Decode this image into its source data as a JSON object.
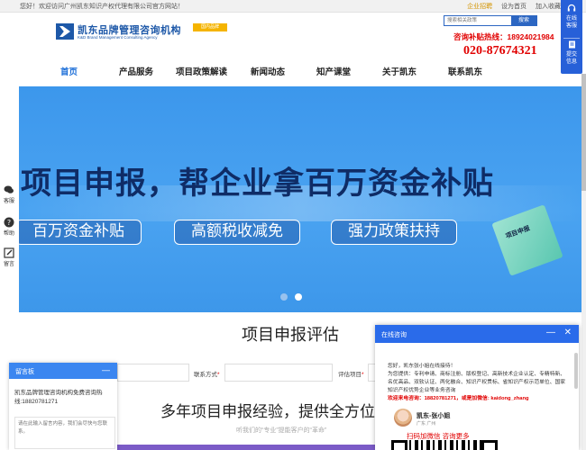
{
  "topbar": {
    "welcome": "您好！欢迎访问广州凯东知识产权代理有限公司官方网站！",
    "links": [
      "企业招聘",
      "设为首页",
      "加入收藏"
    ]
  },
  "logo": {
    "name_cn": "凯东品牌管理咨询机构",
    "name_en": "K&D Brand Management Consulting Agency",
    "tag": "国内品牌"
  },
  "search": {
    "placeholder": "搜索相关政策",
    "button": "搜索"
  },
  "hotline": {
    "label": "咨询补贴热线：18924021984",
    "number": "020-87674321"
  },
  "nav": {
    "items": [
      "首页",
      "产品服务",
      "项目政策解读",
      "新闻动态",
      "知产课堂",
      "关于凯东",
      "联系凯东"
    ]
  },
  "banner": {
    "title": "项目申报，帮企业拿百万资金补贴",
    "pills": [
      "百万资金补贴",
      "高额税收减免",
      "强力政策扶持"
    ],
    "doc_label": "项目申报",
    "active_slide": 2,
    "slide_count": 2
  },
  "section": {
    "title": "项目申报评估",
    "contact_label": "联系方式",
    "project_label": "评估项目",
    "subtitle": "多年项目申报经验，提供全方位",
    "tagline": "听我们的“专业”提能客户的“革命”"
  },
  "side_left": [
    "客服",
    "帮助",
    "留言"
  ],
  "side_right": [
    "在线客服",
    "提交信息"
  ],
  "message_board": {
    "title": "留言板",
    "minimize": "—",
    "body": "凯东品牌管理咨询机构免费咨询热线:18820781271",
    "placeholder": "请在此输入留言内容，我们会尽快与您联系。"
  },
  "chat": {
    "title": "在线咨询",
    "minimize": "—",
    "close": "✕",
    "greeting": "您好，凯东张小姐在线接待！",
    "services": "为您提供：专利申请、商标注册、版权登记、高新技术企业认定、专精特新、名优高品、双软认证、两化融合、知识产权贯标、省知识产权示范单位、国家知识产权优势企业等业务咨询",
    "contact": "欢迎来电咨询：18820781271，或是加微信: kaidong_zhang",
    "agent_name": "凯东-张小姐",
    "agent_loc": "广东 广州",
    "wechat_cta": "扫码加微信 咨询更多"
  },
  "colors": {
    "brand_blue": "#1d58a8",
    "nav_active": "#1d6fd8",
    "hotline_red": "#e10000",
    "banner_blue": "#4aa3f1",
    "chat_header": "#2a6bea"
  }
}
